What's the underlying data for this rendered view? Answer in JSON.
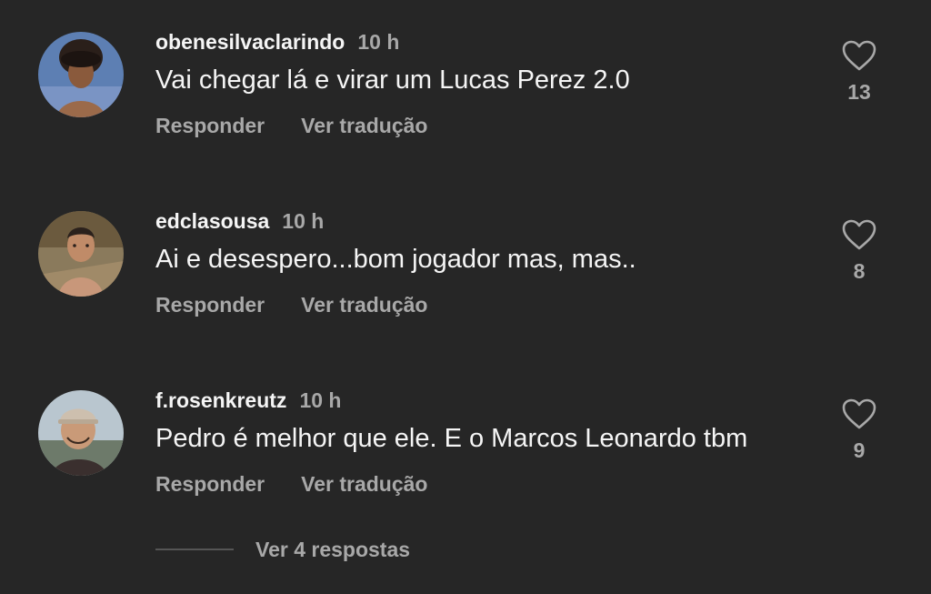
{
  "comments": [
    {
      "username": "obenesilvaclarindo",
      "time": "10 h",
      "text": "Vai chegar lá e virar um Lucas Perez 2.0",
      "reply_label": "Responder",
      "translate_label": "Ver tradução",
      "likes": "13",
      "avatar": "avatar-icon"
    },
    {
      "username": "edclasousa",
      "time": "10 h",
      "text": "Ai e desespero...bom jogador mas, mas..",
      "reply_label": "Responder",
      "translate_label": "Ver tradução",
      "likes": "8",
      "avatar": "avatar-icon"
    },
    {
      "username": "f.rosenkreutz",
      "time": "10 h",
      "text": "Pedro é melhor que ele. E o Marcos Leonardo tbm",
      "reply_label": "Responder",
      "translate_label": "Ver tradução",
      "likes": "9",
      "avatar": "avatar-icon"
    }
  ],
  "view_replies": "Ver 4 respostas",
  "colors": {
    "background": "#262626",
    "primary_text": "#f5f5f5",
    "secondary_text": "#a8a8a8"
  },
  "icons": {
    "like": "heart-outline-icon"
  }
}
